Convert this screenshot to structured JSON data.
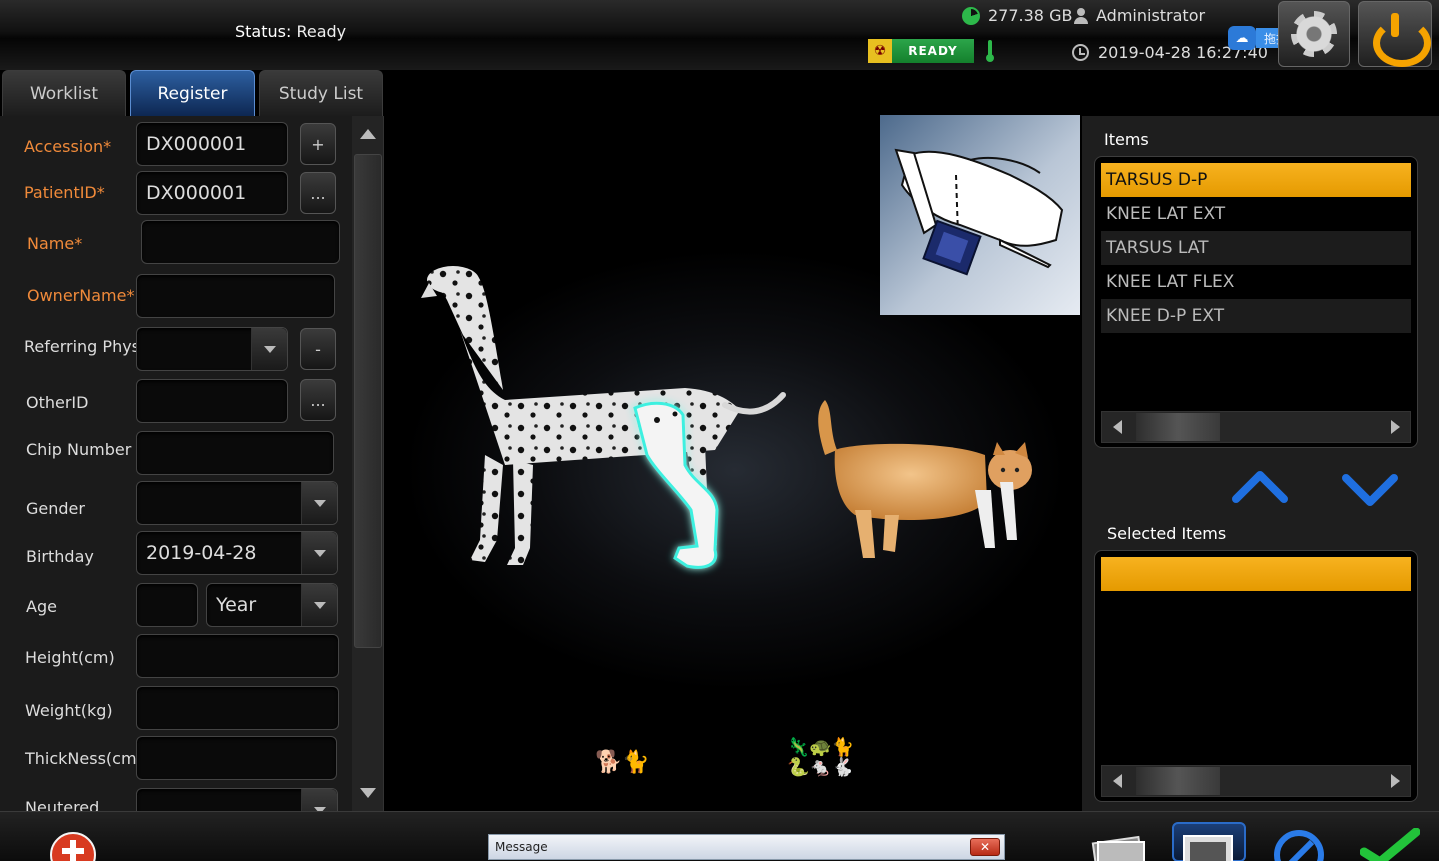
{
  "topbar": {
    "status_label": "Status:",
    "status_value": "Ready",
    "disk_free": "277.38 GB",
    "user": "Administrator",
    "datetime": "2019-04-28 16:27:40",
    "ready_badge": "READY",
    "upload_label": "拖拽上传"
  },
  "tabs": [
    {
      "label": "Worklist",
      "active": false
    },
    {
      "label": "Register",
      "active": true
    },
    {
      "label": "Study List",
      "active": false
    }
  ],
  "form": {
    "accession": {
      "label": "Accession*",
      "value": "DX000001",
      "button": "+"
    },
    "patient_id": {
      "label": "PatientID*",
      "value": "DX000001",
      "button": "..."
    },
    "name": {
      "label": "Name*",
      "value": ""
    },
    "owner_name": {
      "label": "OwnerName*",
      "value": ""
    },
    "referring_phys": {
      "label": "Referring Phys",
      "value": "",
      "button": "-"
    },
    "other_id": {
      "label": "OtherID",
      "value": "",
      "button": "..."
    },
    "chip_number": {
      "label": "Chip Number",
      "value": ""
    },
    "gender": {
      "label": "Gender",
      "value": ""
    },
    "birthday": {
      "label": "Birthday",
      "value": "2019-04-28"
    },
    "age": {
      "label": "Age",
      "value": "",
      "unit": "Year"
    },
    "height": {
      "label": "Height(cm)",
      "value": ""
    },
    "weight": {
      "label": "Weight(kg)",
      "value": ""
    },
    "thickness": {
      "label": "ThickNess(cm)",
      "value": ""
    },
    "neutered": {
      "label": "Neutered",
      "value": ""
    }
  },
  "items": {
    "title": "Items",
    "list": [
      "TARSUS D-P",
      "KNEE LAT EXT",
      "TARSUS LAT",
      "KNEE LAT FLEX",
      "KNEE D-P EXT"
    ],
    "selected_index": 0
  },
  "selected_items": {
    "title": "Selected Items",
    "list": [
      ""
    ]
  },
  "bottom": {
    "message_title": "Message",
    "message_close": "✕"
  },
  "colors": {
    "accent_orange": "#f5a300",
    "required_label": "#f08a3a",
    "tab_active": "#1f4f8e",
    "ready_green": "#1e9a3c",
    "bone_glow": "#3ef0e0"
  }
}
